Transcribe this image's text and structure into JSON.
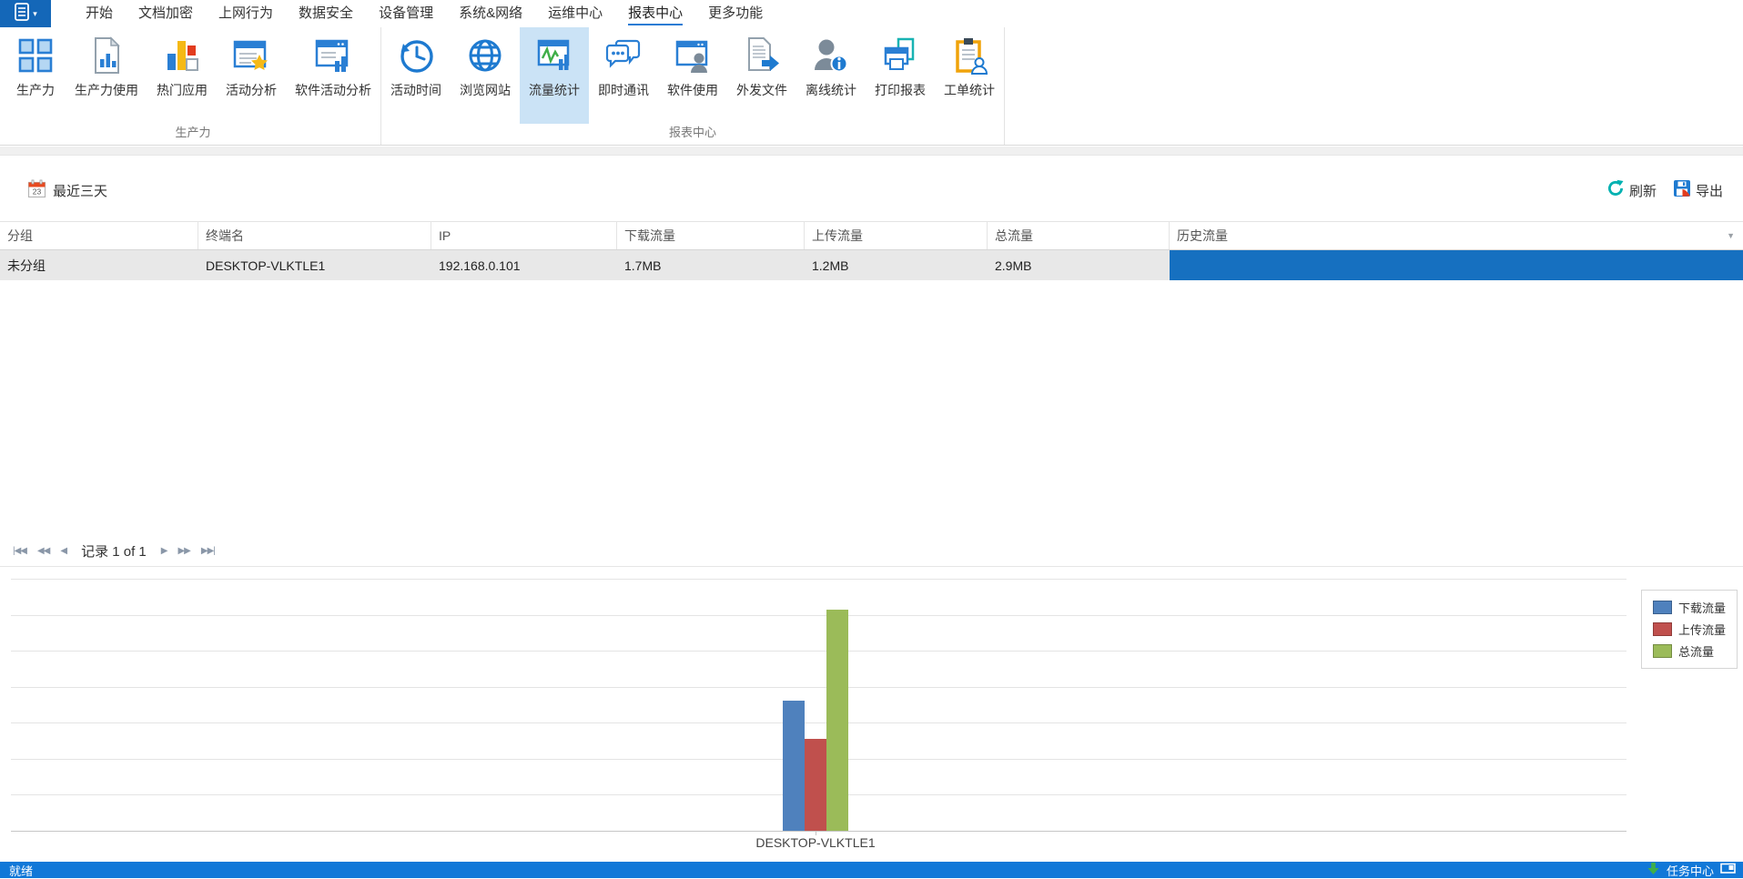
{
  "menu_tabs": [
    {
      "label": "开始",
      "active": false
    },
    {
      "label": "文档加密",
      "active": false
    },
    {
      "label": "上网行为",
      "active": false
    },
    {
      "label": "数据安全",
      "active": false
    },
    {
      "label": "设备管理",
      "active": false
    },
    {
      "label": "系统&网络",
      "active": false
    },
    {
      "label": "运维中心",
      "active": false
    },
    {
      "label": "报表中心",
      "active": true
    },
    {
      "label": "更多功能",
      "active": false
    }
  ],
  "ribbon": {
    "groups": [
      {
        "label": "生产力",
        "items": [
          {
            "label": "生产力",
            "icon": "grid-icon",
            "selected": false
          },
          {
            "label": "生产力使用",
            "icon": "document-chart-icon",
            "selected": false
          },
          {
            "label": "热门应用",
            "icon": "bar-chart-icon",
            "selected": false
          },
          {
            "label": "活动分析",
            "icon": "window-star-icon",
            "selected": false
          },
          {
            "label": "软件活动分析",
            "icon": "window-chart-icon",
            "selected": false
          }
        ]
      },
      {
        "label": "报表中心",
        "items": [
          {
            "label": "活动时间",
            "icon": "history-clock-icon",
            "selected": false
          },
          {
            "label": "浏览网站",
            "icon": "globe-icon",
            "selected": false
          },
          {
            "label": "流量统计",
            "icon": "traffic-chart-icon",
            "selected": true
          },
          {
            "label": "即时通讯",
            "icon": "chat-icon",
            "selected": false
          },
          {
            "label": "软件使用",
            "icon": "window-user-icon",
            "selected": false
          },
          {
            "label": "外发文件",
            "icon": "file-export-icon",
            "selected": false
          },
          {
            "label": "离线统计",
            "icon": "user-info-icon",
            "selected": false
          },
          {
            "label": "打印报表",
            "icon": "printer-icon",
            "selected": false
          },
          {
            "label": "工单统计",
            "icon": "clipboard-user-icon",
            "selected": false
          }
        ]
      }
    ]
  },
  "toolbar": {
    "date_filter": {
      "label": "最近三天",
      "icon": "calendar-icon"
    },
    "refresh": {
      "label": "刷新",
      "icon": "refresh-icon"
    },
    "export": {
      "label": "导出",
      "icon": "export-icon"
    }
  },
  "table": {
    "columns": [
      "分组",
      "终端名",
      "IP",
      "下载流量",
      "上传流量",
      "总流量",
      "历史流量"
    ],
    "rows": [
      {
        "cells": [
          "未分组",
          "DESKTOP-VLKTLE1",
          "192.168.0.101",
          "1.7MB",
          "1.2MB",
          "2.9MB",
          ""
        ]
      }
    ],
    "history_bar_color": "#1670c0"
  },
  "pager": {
    "record_text": "记录 1 of 1",
    "buttons_left": [
      "first-page-icon",
      "fast-backward-icon",
      "prev-page-icon"
    ],
    "buttons_right": [
      "next-page-icon",
      "fast-forward-icon",
      "last-page-icon"
    ]
  },
  "chart_data": {
    "type": "bar",
    "categories": [
      "DESKTOP-VLKTLE1"
    ],
    "series": [
      {
        "name": "下载流量",
        "values": [
          1.7
        ],
        "color": "#4f81bd"
      },
      {
        "name": "上传流量",
        "values": [
          1.2
        ],
        "color": "#c0504d"
      },
      {
        "name": "总流量",
        "values": [
          2.9
        ],
        "color": "#9bbb59"
      }
    ],
    "unit": "MB",
    "title": "",
    "xlabel": "",
    "ylabel": "",
    "ylim": [
      0,
      3.3
    ],
    "grid": true,
    "gridline_count": 8,
    "legend_position": "top-right",
    "y_tick_labels_visible": false
  },
  "status_bar": {
    "ready_text": "就绪",
    "task_center_label": "任务中心",
    "accent_color": "#1178d8"
  },
  "colors": {
    "tab_underline": "#2a7cd4",
    "ribbon_selected_bg": "#cbe3f6",
    "app_button_bg": "#1467b8"
  }
}
